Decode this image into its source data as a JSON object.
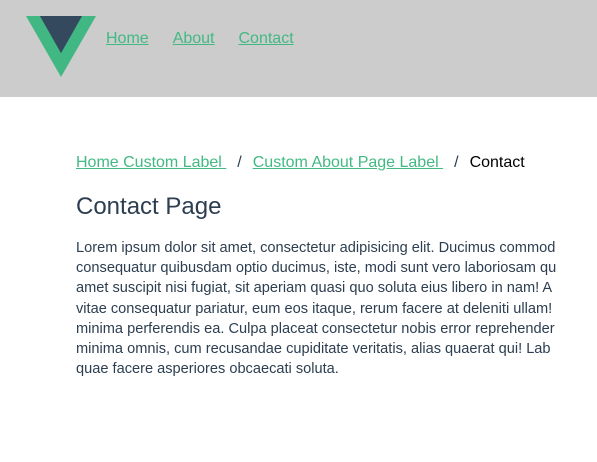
{
  "header": {
    "logo_icon": "vue-logo-icon",
    "colors": {
      "background": "#cccccc",
      "logo_green": "#41b883",
      "logo_dark": "#35495e"
    },
    "nav": [
      {
        "label": "Home"
      },
      {
        "label": "About"
      },
      {
        "label": "Contact"
      }
    ]
  },
  "breadcrumb": {
    "items": [
      {
        "label": "Home Custom Label "
      },
      {
        "label": "Custom About Page Label "
      }
    ],
    "separator": "/",
    "current": "Contact"
  },
  "page": {
    "title": "Contact Page",
    "body_lines": [
      "Lorem ipsum dolor sit amet, consectetur adipisicing elit. Ducimus commod",
      "consequatur quibusdam optio ducimus, iste, modi sunt vero laboriosam qu",
      "amet suscipit nisi fugiat, sit aperiam quasi quo soluta eius libero in nam! A",
      "vitae consequatur pariatur, eum eos itaque, rerum facere at deleniti ullam!",
      "minima perferendis ea. Culpa placeat consectetur nobis error reprehender",
      "minima omnis, cum recusandae cupiditate veritatis, alias quaerat qui! Lab",
      "quae facere asperiores obcaecati soluta."
    ]
  },
  "colors": {
    "link": "#42b983",
    "text": "#2c3e50"
  }
}
